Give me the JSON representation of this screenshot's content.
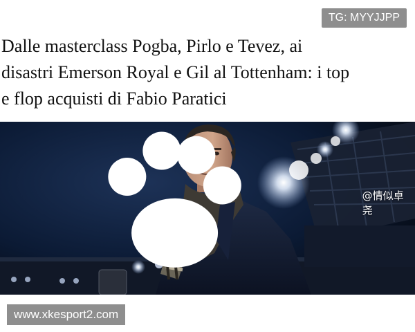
{
  "top_badge": {
    "text": "TG: MYYJJPP"
  },
  "article": {
    "headline_lines": [
      "Dalle masterclass Pogba, Pirlo e Tevez, ai",
      "disastri Emerson Royal e Gil al Tottenham: i top",
      "e flop acquisti di Fabio Paratici"
    ]
  },
  "image": {
    "watermark": "@情似卓尧",
    "paw_icon": "paw-icon"
  },
  "bottom_badge": {
    "text": "www.xkesport2.com"
  },
  "colors": {
    "badge_bg": "#8e8e8e",
    "headline_text": "#111111",
    "stadium_night": "#0b1a34"
  }
}
